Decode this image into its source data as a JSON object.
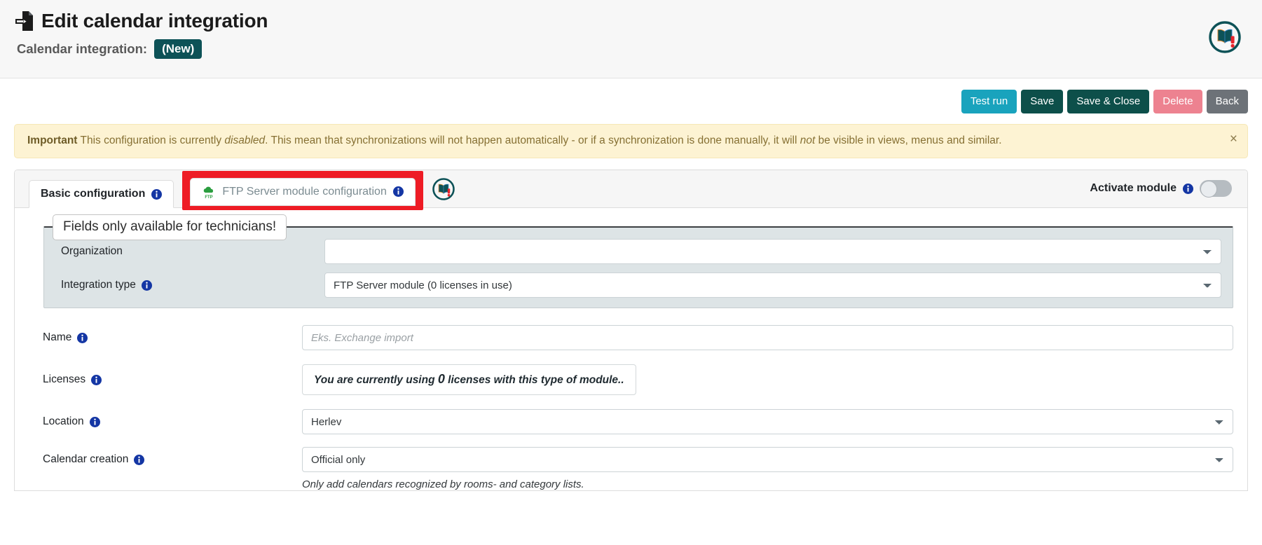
{
  "header": {
    "icon": "document-import-icon",
    "title": "Edit calendar integration",
    "subtitle_label": "Calendar integration:",
    "badge": "(New)",
    "logo_icon": "book-alert-logo"
  },
  "actions": {
    "test_run": "Test run",
    "save": "Save",
    "save_and_close": "Save & Close",
    "delete": "Delete",
    "back": "Back"
  },
  "alert": {
    "strong": "Important",
    "text_1": " This configuration is currently ",
    "em_1": "disabled",
    "text_2": ". This mean that synchronizations will not happen automatically - or if a synchronization is done manually, it will ",
    "em_2": "not",
    "text_3": " be visible in views, menus and similar.",
    "close": "×"
  },
  "tabs": {
    "basic": "Basic configuration",
    "ftp": "FTP Server module configuration",
    "ftp_icon": "ftp-cloud-icon",
    "logo_icon": "book-alert-icon"
  },
  "activate": {
    "label": "Activate module",
    "state": "off"
  },
  "fieldset": {
    "legend": "Fields only available for technicians!",
    "organization": {
      "label": "Organization",
      "value": ""
    },
    "integration_type": {
      "label": "Integration type",
      "value": "FTP Server module (0 licenses in use)"
    }
  },
  "form": {
    "name": {
      "label": "Name",
      "value": "",
      "placeholder": "Eks. Exchange import"
    },
    "licenses": {
      "label": "Licenses",
      "text_before": "You are currently using ",
      "count": "0",
      "text_after": " licenses with this type of module.."
    },
    "location": {
      "label": "Location",
      "value": "Herlev"
    },
    "calendar_creation": {
      "label": "Calendar creation",
      "value": "Official only",
      "help": "Only add calendars recognized by rooms- and category lists."
    }
  },
  "colors": {
    "teal": "#0d5257",
    "cyan": "#19a3bd",
    "danger": "#ed8290",
    "gray": "#6d7278",
    "highlight": "#ee1c25",
    "alert_bg": "#fdf3d3"
  }
}
